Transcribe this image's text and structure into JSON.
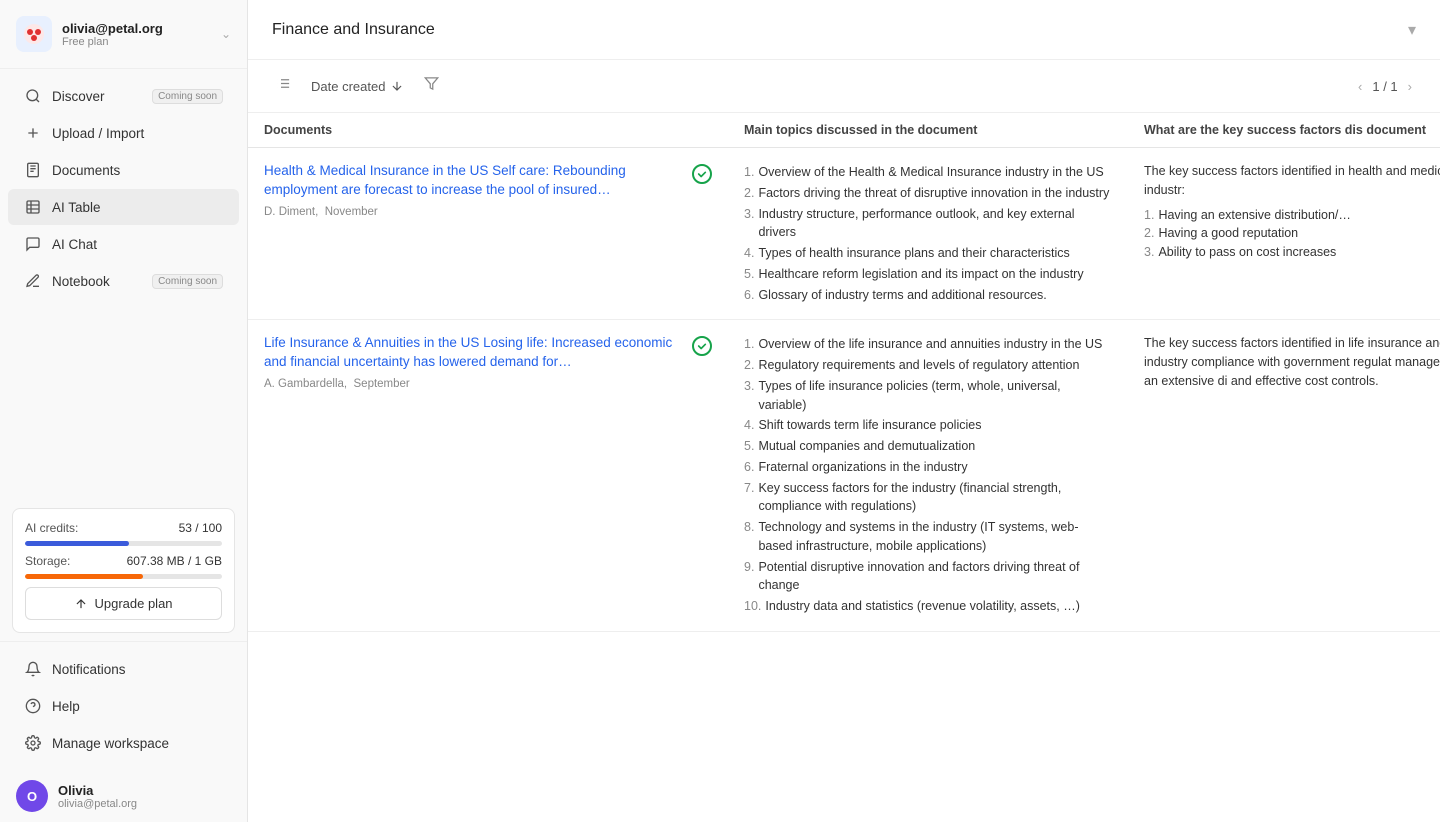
{
  "sidebar": {
    "user": {
      "email": "olivia@petal.org",
      "plan": "Free plan",
      "name": "Olivia",
      "avatar_initial": "O"
    },
    "nav_items": [
      {
        "id": "discover",
        "label": "Discover",
        "icon": "search",
        "badge": "Coming soon"
      },
      {
        "id": "upload",
        "label": "Upload / Import",
        "icon": "plus",
        "badge": ""
      },
      {
        "id": "documents",
        "label": "Documents",
        "icon": "document",
        "badge": ""
      },
      {
        "id": "ai-table",
        "label": "AI Table",
        "icon": "table",
        "badge": "",
        "active": true
      },
      {
        "id": "ai-chat",
        "label": "AI Chat",
        "icon": "chat",
        "badge": ""
      },
      {
        "id": "notebook",
        "label": "Notebook",
        "icon": "pencil",
        "badge": "Coming soon"
      }
    ],
    "credits": {
      "label": "AI credits:",
      "used": 53,
      "total": 100,
      "display": "53 / 100",
      "percent": 53
    },
    "storage": {
      "label": "Storage:",
      "used": "607.38 MB",
      "total": "1 GB",
      "display": "607.38 MB / 1 GB",
      "percent": 60
    },
    "upgrade_label": "Upgrade plan",
    "bottom_items": [
      {
        "id": "notifications",
        "label": "Notifications",
        "icon": "bell"
      },
      {
        "id": "help",
        "label": "Help",
        "icon": "help"
      },
      {
        "id": "manage-workspace",
        "label": "Manage workspace",
        "icon": "gear"
      }
    ]
  },
  "header": {
    "title": "Finance and Insurance",
    "chevron": "▾"
  },
  "toolbar": {
    "sort_label": "Date created",
    "page_info": "1 / 1"
  },
  "table": {
    "columns": [
      {
        "id": "documents",
        "label": "Documents"
      },
      {
        "id": "main-topics",
        "label": "Main topics discussed in the document"
      },
      {
        "id": "key-success",
        "label": "What are the key success factors dis document"
      }
    ],
    "rows": [
      {
        "id": "row-1",
        "title": "Health & Medical Insurance in the US Self care: Rebounding employment are forecast to increase the pool of insured…",
        "author": "D. Diment",
        "date": "November",
        "topics": [
          "Overview of the Health & Medical Insurance industry in the US",
          "Factors driving the threat of disruptive innovation in the industry",
          "Industry structure, performance outlook, and key external drivers",
          "Types of health insurance plans and their characteristics",
          "Healthcare reform legislation and its impact on the industry",
          "Glossary of industry terms and additional resources."
        ],
        "key_success_intro": "The key success factors identified in health and medical insurance industr:",
        "key_success_factors": [
          "Having an extensive distribution/…",
          "Having a good reputation",
          "Ability to pass on cost increases"
        ]
      },
      {
        "id": "row-2",
        "title": "Life Insurance & Annuities in the US Losing life: Increased economic and financial uncertainty has lowered demand for…",
        "author": "A. Gambardella",
        "date": "September",
        "topics": [
          "Overview of the life insurance and annuities industry in the US",
          "Regulatory requirements and levels of regulatory attention",
          "Types of life insurance policies (term, whole, universal, variable)",
          "Shift towards term life insurance policies",
          "Mutual companies and demutualization",
          "Fraternal organizations in the industry",
          "Key success factors for the industry (financial strength, compliance with regulations)",
          "Technology and systems in the industry (IT systems, web-based infrastructure, mobile applications)",
          "Potential disruptive innovation and factors driving threat of change",
          "Industry data and statistics (revenue volatility, assets, …)"
        ],
        "key_success_intro": "The key success factors identified in life insurance and annuities industry compliance with government regulat management, having an extensive di and effective cost controls.",
        "key_success_factors": []
      }
    ]
  }
}
